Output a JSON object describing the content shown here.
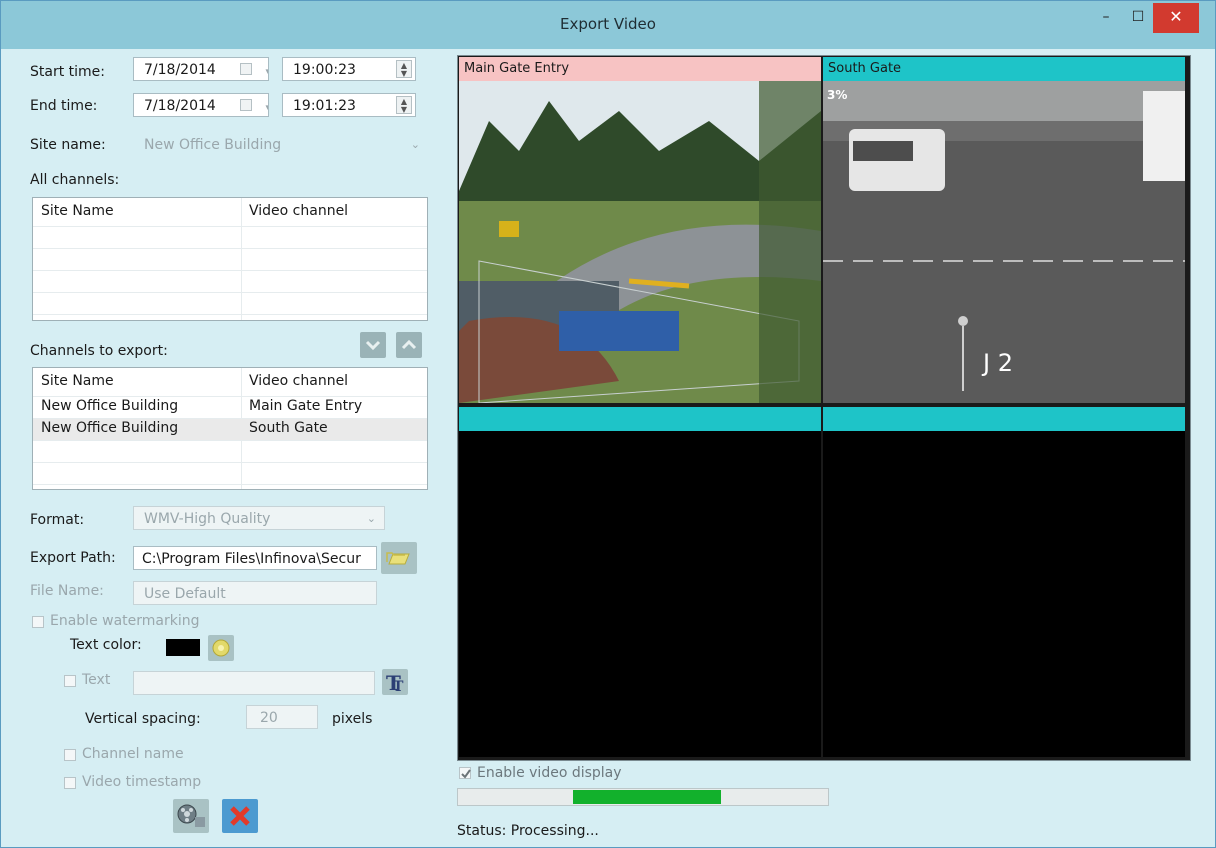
{
  "window": {
    "title": "Export Video",
    "minimize_glyph": "–",
    "maximize_glyph": "☐",
    "close_glyph": "✕"
  },
  "form": {
    "start_time": {
      "label": "Start time:",
      "date": "7/18/2014",
      "time": "19:00:23"
    },
    "end_time": {
      "label": "End time:",
      "date": "7/18/2014",
      "time": "19:01:23"
    },
    "site_name": {
      "label": "Site name:",
      "value": "New Office Building"
    },
    "all_channels": {
      "label": "All channels:",
      "columns": [
        "Site Name",
        "Video channel"
      ],
      "rows": []
    },
    "channels_to_export": {
      "label": "Channels to export:",
      "columns": [
        "Site Name",
        "Video channel"
      ],
      "rows": [
        {
          "site": "New Office Building",
          "channel": "Main Gate Entry"
        },
        {
          "site": "New Office Building",
          "channel": "South Gate"
        }
      ]
    },
    "format": {
      "label": "Format:",
      "value": "WMV-High Quality"
    },
    "export_path": {
      "label": "Export Path:",
      "value": "C:\\Program Files\\Infinova\\Secur"
    },
    "file_name": {
      "label": "File Name:",
      "value": "Use Default"
    },
    "watermark": {
      "enable_label": "Enable watermarking",
      "text_color_label": "Text color:",
      "text_color": "#000000",
      "text_label": "Text",
      "vertical_spacing_label": "Vertical spacing:",
      "vertical_spacing_value": "20",
      "pixels_label": "pixels",
      "channel_name_label": "Channel name",
      "video_timestamp_label": "Video timestamp"
    }
  },
  "videos": [
    {
      "name": "Main Gate Entry",
      "header_color": "#f7c3c3",
      "overlay": ""
    },
    {
      "name": "South Gate",
      "header_color": "#1ec4c8",
      "overlay": "3%",
      "camera_label": "J 2"
    },
    {
      "name": "",
      "header_color": "#1ec4c8"
    },
    {
      "name": "",
      "header_color": "#1ec4c8"
    }
  ],
  "display": {
    "enable_video_label": "Enable video display",
    "enabled": true
  },
  "progress": {
    "start_fraction": 0.31,
    "end_fraction": 0.71
  },
  "status": {
    "text": "Status: Processing..."
  },
  "icons": {
    "calendar": "calendar-icon",
    "move_down": "chevron-down-icon",
    "move_up": "chevron-up-icon",
    "browse": "folder-icon",
    "color_picker": "palette-icon",
    "font": "font-icon",
    "export": "film-export-icon",
    "cancel": "close-icon"
  }
}
